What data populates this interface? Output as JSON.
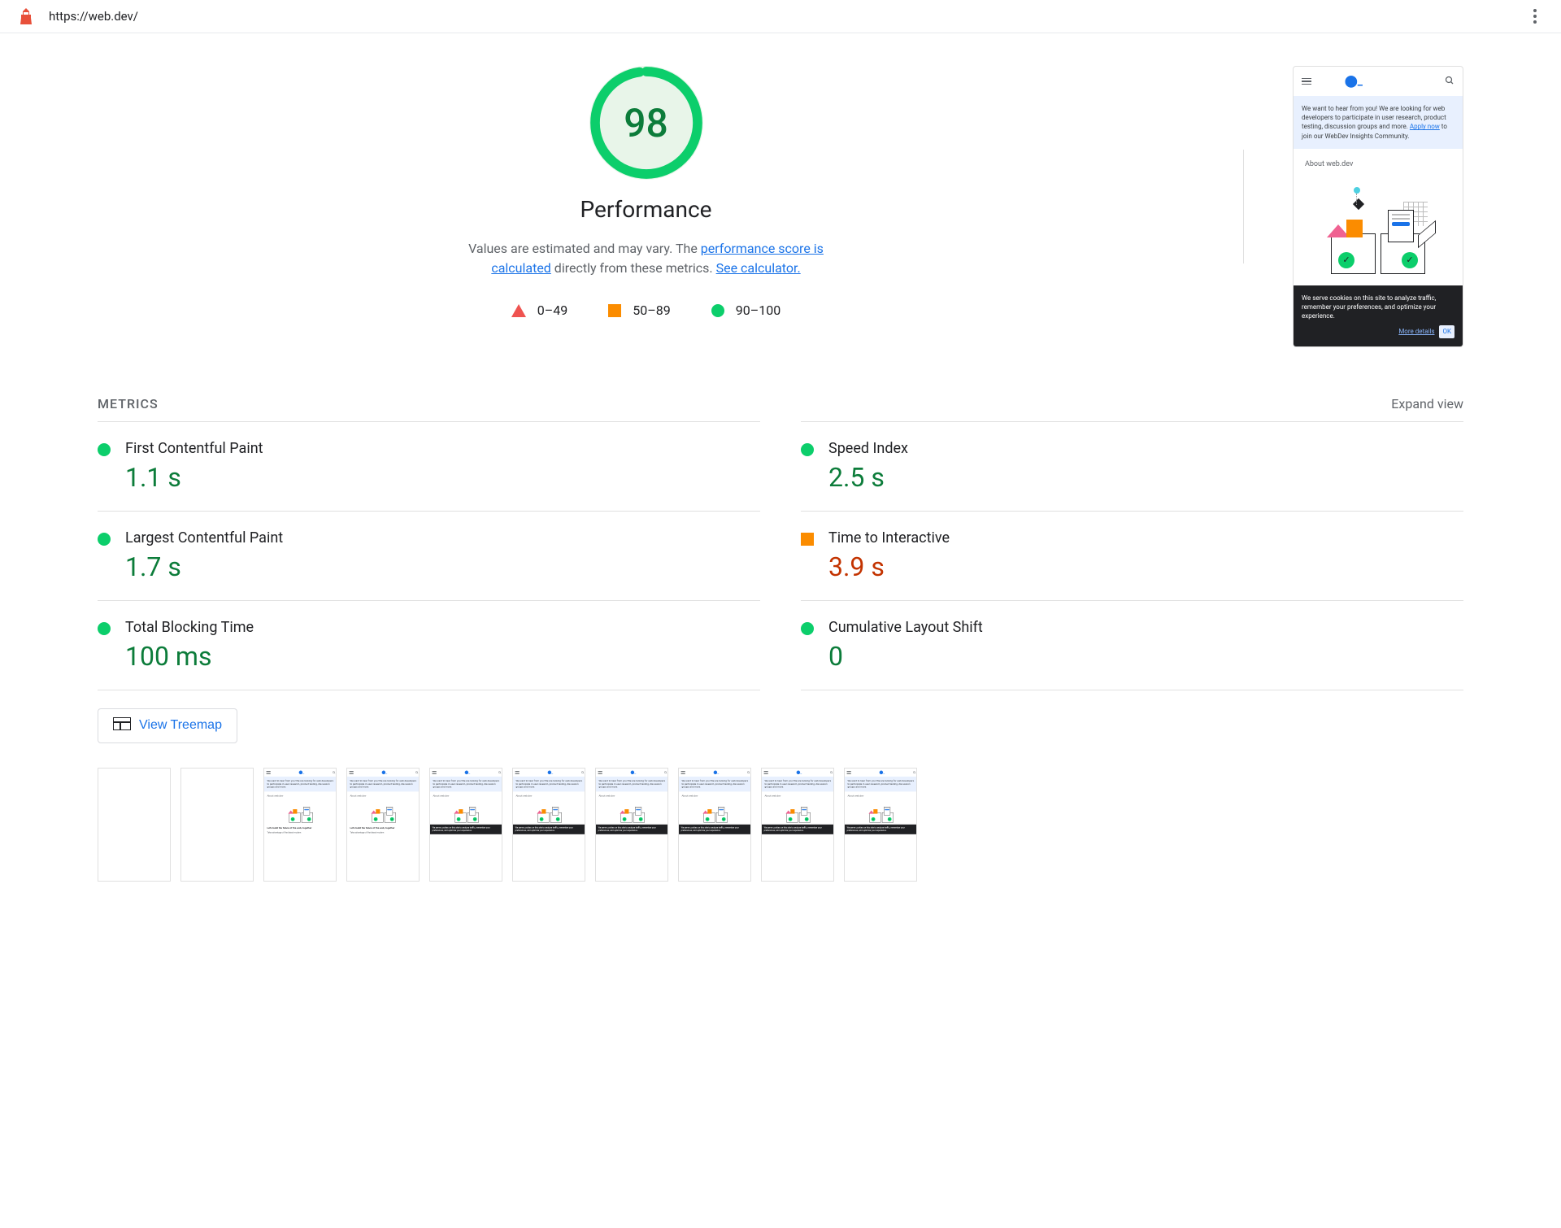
{
  "header": {
    "url": "https://web.dev/"
  },
  "score": {
    "value": "98",
    "category": "Performance",
    "description_prefix": "Values are estimated and may vary. The ",
    "link1_text": "performance score is calculated",
    "description_mid": " directly from these metrics. ",
    "link2_text": "See calculator."
  },
  "legend": {
    "fail_range": "0–49",
    "average_range": "50–89",
    "pass_range": "90–100"
  },
  "screenshot": {
    "banner_text": "We want to hear from you! We are looking for web developers to participate in user research, product testing, discussion groups and more. ",
    "banner_link": "Apply now",
    "banner_suffix": " to join our WebDev Insights Community.",
    "about_text": "About web.dev",
    "cookie_text": "We serve cookies on this site to analyze traffic, remember your preferences, and optimize your experience.",
    "more_details": "More details",
    "ok_button": "OK"
  },
  "metrics": {
    "title": "METRICS",
    "expand_label": "Expand view",
    "items": [
      {
        "name": "First Contentful Paint",
        "value": "1.1 s",
        "status": "green"
      },
      {
        "name": "Speed Index",
        "value": "2.5 s",
        "status": "green"
      },
      {
        "name": "Largest Contentful Paint",
        "value": "1.7 s",
        "status": "green"
      },
      {
        "name": "Time to Interactive",
        "value": "3.9 s",
        "status": "orange"
      },
      {
        "name": "Total Blocking Time",
        "value": "100 ms",
        "status": "green"
      },
      {
        "name": "Cumulative Layout Shift",
        "value": "0",
        "status": "green"
      }
    ]
  },
  "treemap": {
    "label": "View Treemap"
  },
  "filmstrip": {
    "build_text": "Let's build the future of the web, together",
    "coverage_text": "Take advantage of the latest modern"
  }
}
